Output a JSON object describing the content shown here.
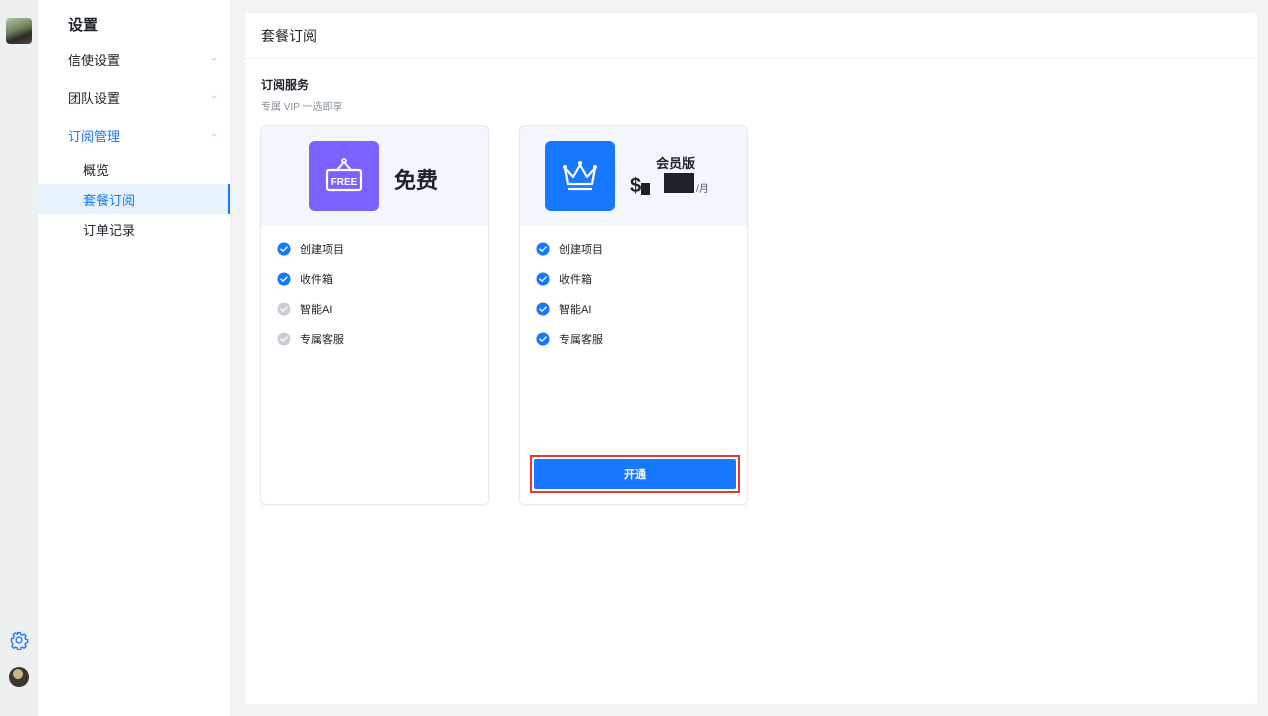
{
  "sidebar": {
    "title": "设置",
    "groups": [
      {
        "label": "信使设置"
      },
      {
        "label": "团队设置"
      },
      {
        "label": "订阅管理"
      }
    ],
    "sub_items": [
      {
        "label": "概览"
      },
      {
        "label": "套餐订阅"
      },
      {
        "label": "订单记录"
      }
    ]
  },
  "main": {
    "header": "套餐订阅",
    "section_title": "订阅服务",
    "section_subtitle": "专属 VIP 一选即享"
  },
  "plans": {
    "free": {
      "icon_text": "FREE",
      "name": "免费",
      "features": [
        "创建项目",
        "收件箱",
        "智能AI",
        "专属客服"
      ],
      "feature_enabled": [
        true,
        true,
        false,
        false
      ]
    },
    "vip": {
      "name": "会员版",
      "currency": "$",
      "unit": "/月",
      "features": [
        "创建项目",
        "收件箱",
        "智能AI",
        "专属客服"
      ],
      "feature_enabled": [
        true,
        true,
        true,
        true
      ],
      "button_label": "开通"
    }
  },
  "colors": {
    "accent": "#1677ff",
    "free_icon_bg": "#7b61ff",
    "check_on": "#1677ff",
    "check_off": "#c9cdd4",
    "highlight_border": "#e53935"
  },
  "icons": {
    "rail_settings": "gear-icon",
    "free_plan": "free-sign-icon",
    "vip_plan": "crown-icon",
    "feature_check": "check-circle-icon"
  }
}
